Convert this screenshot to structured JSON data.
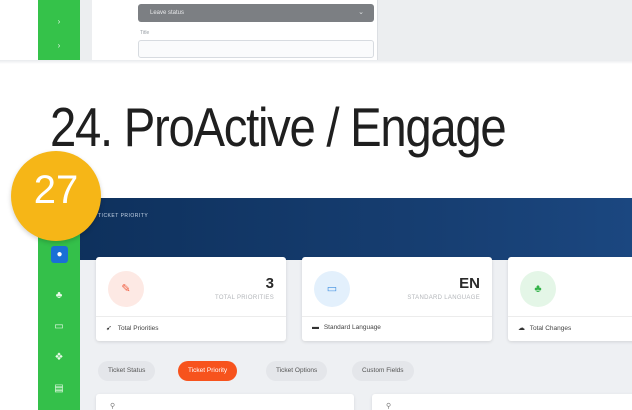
{
  "top_preview": {
    "select_value": "Leave status",
    "title_label": "Title"
  },
  "heading": "24. ProActive / Engage",
  "badge": "27",
  "app": {
    "topbar_title": "TICKET PRIORITY",
    "kpis": [
      {
        "value": "3",
        "label": "TOTAL PRIORITIES",
        "footer": "Total Priorities",
        "icon": "tag-icon",
        "accent": "#f05a3c"
      },
      {
        "value": "EN",
        "label": "STANDARD LANGUAGE",
        "footer": "Standard Language",
        "icon": "language-icon",
        "accent": "#3d8fe0"
      },
      {
        "value": "",
        "label": "",
        "footer": "Total Changes",
        "icon": "exchange-icon",
        "accent": "#34b249"
      }
    ],
    "tabs": [
      "Ticket Status",
      "Ticket Priority",
      "Ticket Options",
      "Custom Fields"
    ],
    "active_tab": "Ticket Priority"
  },
  "colors": {
    "rail": "#34c04a",
    "topbar": "#0d2f5a",
    "active_tab": "#f7531d",
    "badge": "#f6b617"
  }
}
